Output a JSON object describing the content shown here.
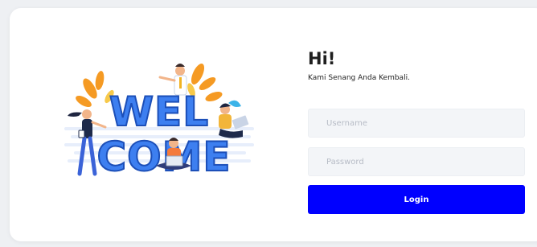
{
  "illustration": {
    "word_top": "WEL",
    "word_bottom": "COME"
  },
  "login": {
    "greeting": "Hi!",
    "subtitle": "Kami Senang Anda Kembali.",
    "username_placeholder": "Username",
    "password_placeholder": "Password",
    "button_label": "Login"
  },
  "colors": {
    "accent": "#0000ff",
    "input_bg": "#f3f5f8",
    "welcome_blue": "#3d7ff0",
    "leaf_orange": "#f59a23"
  }
}
